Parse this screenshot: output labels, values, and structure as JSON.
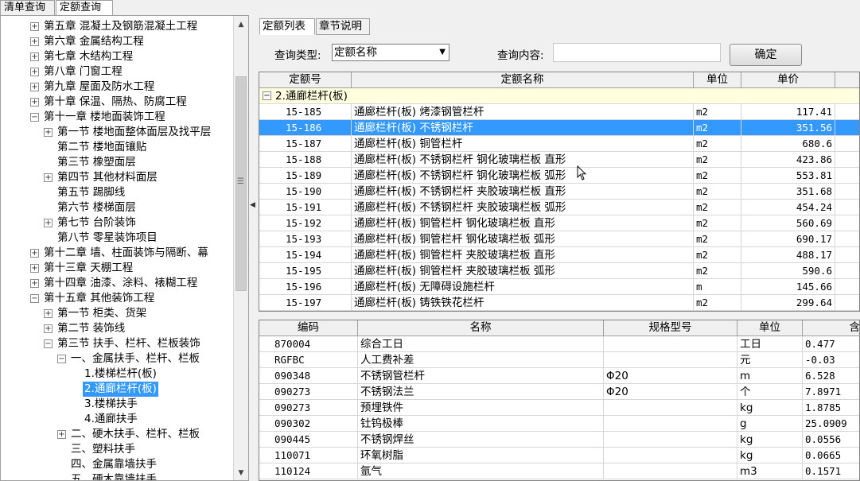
{
  "top_tabs": [
    {
      "label": "清单查询",
      "active": false
    },
    {
      "label": "定额查询",
      "active": true
    }
  ],
  "tree": [
    {
      "level": 0,
      "exp": "+",
      "label": "第五章  混凝土及钢筋混凝土工程"
    },
    {
      "level": 0,
      "exp": "+",
      "label": "第六章  金属结构工程"
    },
    {
      "level": 0,
      "exp": "+",
      "label": "第七章  木结构工程"
    },
    {
      "level": 0,
      "exp": "+",
      "label": "第八章  门窗工程"
    },
    {
      "level": 0,
      "exp": "+",
      "label": "第九章  屋面及防水工程"
    },
    {
      "level": 0,
      "exp": "+",
      "label": "第十章  保温、隔热、防腐工程"
    },
    {
      "level": 0,
      "exp": "-",
      "label": "第十一章  楼地面装饰工程"
    },
    {
      "level": 1,
      "exp": "+",
      "label": "第一节  楼地面整体面层及找平层"
    },
    {
      "level": 1,
      "exp": "",
      "label": "第二节  楼地面镶贴"
    },
    {
      "level": 1,
      "exp": "",
      "label": "第三节  橡塑面层"
    },
    {
      "level": 1,
      "exp": "+",
      "label": "第四节  其他材料面层"
    },
    {
      "level": 1,
      "exp": "",
      "label": "第五节  踢脚线"
    },
    {
      "level": 1,
      "exp": "",
      "label": "第六节  楼梯面层"
    },
    {
      "level": 1,
      "exp": "+",
      "label": "第七节  台阶装饰"
    },
    {
      "level": 1,
      "exp": "",
      "label": "第八节  零星装饰项目"
    },
    {
      "level": 0,
      "exp": "+",
      "label": "第十二章  墙、柱面装饰与隔断、幕"
    },
    {
      "level": 0,
      "exp": "+",
      "label": "第十三章  天棚工程"
    },
    {
      "level": 0,
      "exp": "+",
      "label": "第十四章  油漆、涂料、裱糊工程"
    },
    {
      "level": 0,
      "exp": "-",
      "label": "第十五章  其他装饰工程"
    },
    {
      "level": 1,
      "exp": "+",
      "label": "第一节  柜类、货架"
    },
    {
      "level": 1,
      "exp": "+",
      "label": "第二节  装饰线"
    },
    {
      "level": 1,
      "exp": "-",
      "label": "第三节  扶手、栏杆、栏板装饰"
    },
    {
      "level": 2,
      "exp": "-",
      "label": "一、金属扶手、栏杆、栏板"
    },
    {
      "level": 3,
      "exp": "",
      "label": "1.楼梯栏杆(板)"
    },
    {
      "level": 3,
      "exp": "",
      "label": "2.通廊栏杆(板)",
      "selected": true
    },
    {
      "level": 3,
      "exp": "",
      "label": "3.楼梯扶手"
    },
    {
      "level": 3,
      "exp": "",
      "label": "4.通廊扶手"
    },
    {
      "level": 2,
      "exp": "+",
      "label": "二、硬木扶手、栏杆、栏板"
    },
    {
      "level": 2,
      "exp": "",
      "label": "三、塑料扶手"
    },
    {
      "level": 2,
      "exp": "",
      "label": "四、金属靠墙扶手"
    },
    {
      "level": 2,
      "exp": "",
      "label": "五、硬木靠墙扶手"
    }
  ],
  "sub_tabs": [
    {
      "label": "定额列表",
      "active": true
    },
    {
      "label": "章节说明",
      "active": false
    }
  ],
  "query": {
    "type_label": "查询类型:",
    "type_value": "定额名称",
    "content_label": "查询内容:",
    "content_value": "",
    "confirm_label": "确定"
  },
  "quota_table": {
    "headers": [
      "定额号",
      "定额名称",
      "单位",
      "单价"
    ],
    "group": "2.通廊栏杆(板)",
    "rows": [
      [
        "15-185",
        "通廊栏杆(板) 烤漆钢管栏杆",
        "m2",
        "117.41"
      ],
      [
        "15-186",
        "通廊栏杆(板) 不锈钢栏杆",
        "m2",
        "351.56"
      ],
      [
        "15-187",
        "通廊栏杆(板) 铜管栏杆",
        "m2",
        "680.6"
      ],
      [
        "15-188",
        "通廊栏杆(板) 不锈钢栏杆 钢化玻璃栏板 直形",
        "m2",
        "423.86"
      ],
      [
        "15-189",
        "通廊栏杆(板) 不锈钢栏杆 钢化玻璃栏板 弧形",
        "m2",
        "553.81"
      ],
      [
        "15-190",
        "通廊栏杆(板) 不锈钢栏杆 夹胶玻璃栏板 直形",
        "m2",
        "351.68"
      ],
      [
        "15-191",
        "通廊栏杆(板) 不锈钢栏杆 夹胶玻璃栏板 弧形",
        "m2",
        "454.24"
      ],
      [
        "15-192",
        "通廊栏杆(板) 铜管栏杆 钢化玻璃栏板 直形",
        "m2",
        "560.69"
      ],
      [
        "15-193",
        "通廊栏杆(板) 铜管栏杆 钢化玻璃栏板 弧形",
        "m2",
        "690.17"
      ],
      [
        "15-194",
        "通廊栏杆(板) 铜管栏杆 夹胶玻璃栏板 直形",
        "m2",
        "488.17"
      ],
      [
        "15-195",
        "通廊栏杆(板) 铜管栏杆 夹胶玻璃栏板 弧形",
        "m2",
        "590.6"
      ],
      [
        "15-196",
        "通廊栏杆(板) 无障碍设施栏杆",
        "m",
        "145.66"
      ],
      [
        "15-197",
        "通廊栏杆(板) 铸铁铁花栏杆",
        "m2",
        "299.64"
      ]
    ],
    "selected_index": 1
  },
  "material_table": {
    "headers": [
      "编码",
      "名称",
      "规格型号",
      "单位",
      "含"
    ],
    "rows": [
      [
        "870004",
        "综合工日",
        "",
        "工日",
        "0.477"
      ],
      [
        "RGFBC",
        "人工费补差",
        "",
        "元",
        "-0.03"
      ],
      [
        "090348",
        "不锈钢管栏杆",
        "Φ20",
        "m",
        "6.528"
      ],
      [
        "090273",
        "不锈钢法兰",
        "Φ20",
        "个",
        "7.8971"
      ],
      [
        "090273",
        "预埋铁件",
        "",
        "kg",
        "1.8785"
      ],
      [
        "090302",
        "钍钨极棒",
        "",
        "g",
        "25.0909"
      ],
      [
        "090445",
        "不锈钢焊丝",
        "",
        "kg",
        "0.0556"
      ],
      [
        "110071",
        "环氧树脂",
        "",
        "kg",
        "0.0665"
      ],
      [
        "110124",
        "氩气",
        "",
        "m3",
        "0.1571"
      ]
    ]
  },
  "colors": {
    "selection": "#3399ff",
    "group_bg": "#ffffe0"
  }
}
